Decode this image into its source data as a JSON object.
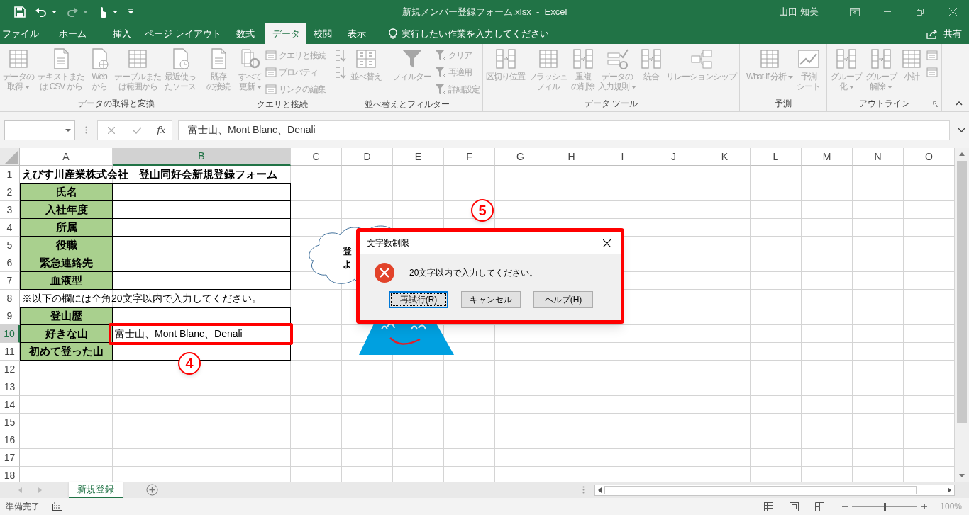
{
  "title_bar": {
    "title": "新規メンバー登録フォーム.xlsx  -  Excel",
    "user": "山田 知美"
  },
  "menu_tabs": [
    {
      "label": "ファイル",
      "selected": false
    },
    {
      "label": "ホーム",
      "selected": false
    },
    {
      "label": "挿入",
      "selected": false
    },
    {
      "label": "ページ レイアウト",
      "selected": false
    },
    {
      "label": "数式",
      "selected": false
    },
    {
      "label": "データ",
      "selected": true
    },
    {
      "label": "校閲",
      "selected": false
    },
    {
      "label": "表示",
      "selected": false
    }
  ],
  "tell_me": {
    "label": "実行したい作業を入力してください"
  },
  "share": {
    "label": "共有"
  },
  "ribbon": {
    "groups": [
      {
        "label": "データの取得と変換",
        "items": [
          {
            "kind": "large",
            "lines": [
              "データの",
              "取得"
            ],
            "dropdown": true,
            "disabled": true
          },
          {
            "kind": "large",
            "lines": [
              "テキストまた",
              "は CSV から"
            ],
            "dropdown": false,
            "disabled": true
          },
          {
            "kind": "large",
            "lines": [
              "Web",
              "から"
            ],
            "dropdown": false,
            "disabled": true
          },
          {
            "kind": "large",
            "lines": [
              "テーブルまた",
              "は範囲から"
            ],
            "dropdown": false,
            "disabled": true
          },
          {
            "kind": "large",
            "lines": [
              "最近使っ",
              "たソース"
            ],
            "dropdown": false,
            "disabled": true
          },
          {
            "kind": "separator"
          },
          {
            "kind": "large",
            "lines": [
              "既存",
              "の接続"
            ],
            "dropdown": false,
            "disabled": true
          }
        ]
      },
      {
        "label": "クエリと接続",
        "items": [
          {
            "kind": "large",
            "lines": [
              "すべて",
              "更新"
            ],
            "dropdown": true,
            "disabled": true
          },
          {
            "kind": "stack",
            "items": [
              {
                "label": "クエリと接続",
                "disabled": true
              },
              {
                "label": "プロパティ",
                "disabled": true
              },
              {
                "label": "リンクの編集",
                "disabled": true
              }
            ]
          }
        ]
      },
      {
        "label": "並べ替えとフィルター",
        "items": [
          {
            "kind": "stack",
            "items": [
              {
                "disabled": true
              },
              {
                "disabled": true
              }
            ]
          },
          {
            "kind": "large",
            "lines": [
              "並べ替え"
            ],
            "dropdown": false,
            "disabled": true
          },
          {
            "kind": "separator"
          },
          {
            "kind": "large",
            "lines": [
              "フィルター"
            ],
            "dropdown": false,
            "disabled": true
          },
          {
            "kind": "stack",
            "items": [
              {
                "label": "クリア",
                "disabled": true
              },
              {
                "label": "再適用",
                "disabled": true
              },
              {
                "label": "詳細設定",
                "disabled": true
              }
            ]
          }
        ]
      },
      {
        "label": "データ ツール",
        "items": [
          {
            "kind": "large",
            "lines": [
              "区切り位置"
            ],
            "dropdown": false,
            "disabled": true
          },
          {
            "kind": "large",
            "lines": [
              "フラッシュ",
              "フィル"
            ],
            "dropdown": false,
            "disabled": true
          },
          {
            "kind": "large",
            "lines": [
              "重複",
              "の削除"
            ],
            "dropdown": false,
            "disabled": true
          },
          {
            "kind": "large",
            "lines": [
              "データの",
              "入力規則"
            ],
            "dropdown": true,
            "disabled": true
          },
          {
            "kind": "large",
            "lines": [
              "統合"
            ],
            "dropdown": false,
            "disabled": true
          },
          {
            "kind": "large",
            "lines": [
              "リレーションシップ"
            ],
            "dropdown": false,
            "disabled": true
          }
        ]
      },
      {
        "label": "予測",
        "items": [
          {
            "kind": "large",
            "lines": [
              "What-If 分析"
            ],
            "dropdown": true,
            "disabled": true
          },
          {
            "kind": "large",
            "lines": [
              "予測",
              "シート"
            ],
            "dropdown": false,
            "disabled": true
          }
        ]
      },
      {
        "label": "アウトライン",
        "items": [
          {
            "kind": "large",
            "lines": [
              "グループ",
              "化"
            ],
            "dropdown": true,
            "disabled": true
          },
          {
            "kind": "large",
            "lines": [
              "グループ",
              "解除"
            ],
            "dropdown": true,
            "disabled": true
          },
          {
            "kind": "large",
            "lines": [
              "小計"
            ],
            "dropdown": false,
            "disabled": true
          },
          {
            "kind": "stack",
            "items": [
              {
                "disabled": true
              },
              {
                "disabled": true
              }
            ]
          }
        ]
      }
    ]
  },
  "formula_bar": {
    "fx": "fx",
    "value": "富士山、Mont Blanc、Denali"
  },
  "columns": [
    {
      "label": "A",
      "selected": false
    },
    {
      "label": "B",
      "selected": true
    },
    {
      "label": "C",
      "selected": false
    },
    {
      "label": "D",
      "selected": false
    },
    {
      "label": "E",
      "selected": false
    },
    {
      "label": "F",
      "selected": false
    },
    {
      "label": "G",
      "selected": false
    },
    {
      "label": "H",
      "selected": false
    },
    {
      "label": "I",
      "selected": false
    },
    {
      "label": "J",
      "selected": false
    },
    {
      "label": "K",
      "selected": false
    },
    {
      "label": "L",
      "selected": false
    },
    {
      "label": "M",
      "selected": false
    },
    {
      "label": "N",
      "selected": false
    },
    {
      "label": "O",
      "selected": false
    }
  ],
  "rows": [
    {
      "number": "1",
      "selected": false,
      "kind": "title",
      "text": "えびす川産業株式会社　登山同好会新規登録フォーム"
    },
    {
      "number": "2",
      "selected": false,
      "kind": "field",
      "label": "氏名"
    },
    {
      "number": "3",
      "selected": false,
      "kind": "field",
      "label": "入社年度"
    },
    {
      "number": "4",
      "selected": false,
      "kind": "field",
      "label": "所属"
    },
    {
      "number": "5",
      "selected": false,
      "kind": "field",
      "label": "役職"
    },
    {
      "number": "6",
      "selected": false,
      "kind": "field",
      "label": "緊急連絡先"
    },
    {
      "number": "7",
      "selected": false,
      "kind": "field",
      "label": "血液型"
    },
    {
      "number": "8",
      "selected": false,
      "kind": "note",
      "text": "※以下の欄には全角20文字以内で入力してください。"
    },
    {
      "number": "9",
      "selected": false,
      "kind": "field",
      "label": "登山歴"
    },
    {
      "number": "10",
      "selected": true,
      "kind": "field",
      "label": "好きな山",
      "value": "富士山、Mont Blanc、Denali"
    },
    {
      "number": "11",
      "selected": false,
      "kind": "field",
      "label": "初めて登った山"
    },
    {
      "number": "12",
      "selected": false,
      "kind": "blank"
    },
    {
      "number": "13",
      "selected": false,
      "kind": "blank"
    },
    {
      "number": "14",
      "selected": false,
      "kind": "blank"
    },
    {
      "number": "15",
      "selected": false,
      "kind": "blank"
    },
    {
      "number": "16",
      "selected": false,
      "kind": "blank"
    },
    {
      "number": "17",
      "selected": false,
      "kind": "blank"
    },
    {
      "number": "18",
      "selected": false,
      "kind": "blank"
    }
  ],
  "speech_bubble": {
    "lines": [
      "登",
      "よ"
    ]
  },
  "dialog": {
    "title": "文字数制限",
    "message": "20文字以内で入力してください。",
    "buttons": [
      {
        "label": "再試行(R)",
        "default": true
      },
      {
        "label": "キャンセル",
        "default": false
      },
      {
        "label": "ヘルプ(H)",
        "default": false
      }
    ]
  },
  "callouts": [
    {
      "label": "5"
    },
    {
      "label": "4"
    }
  ],
  "sheet_tabs": [
    {
      "label": "新規登録",
      "selected": true
    }
  ],
  "status_bar": {
    "status": "準備完了",
    "zoom": {
      "level": 0.5,
      "label": "100%"
    }
  }
}
